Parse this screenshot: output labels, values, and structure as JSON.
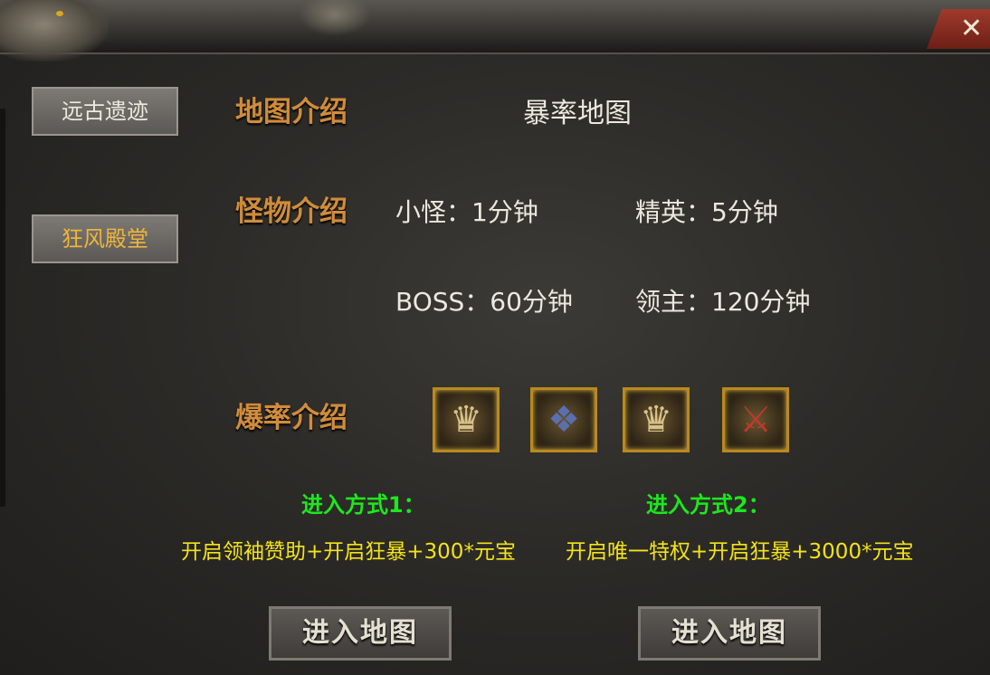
{
  "close_icon": "close-x-icon",
  "sidebar": {
    "items": [
      {
        "label": "远古遗迹",
        "active": false
      },
      {
        "label": "狂风殿堂",
        "active": true
      }
    ]
  },
  "map_intro": {
    "label": "地图介绍",
    "value": "暴率地图"
  },
  "monster_intro": {
    "label": "怪物介绍",
    "small": "小怪：1分钟",
    "elite": "精英：5分钟",
    "boss": "BOSS：60分钟",
    "lord": "领主：120分钟"
  },
  "drop_intro": {
    "label": "爆率介绍",
    "items": [
      "helmet-icon",
      "armor-icon",
      "helmet-icon",
      "sword-icon"
    ]
  },
  "entry": {
    "method1_title": "进入方式1：",
    "method1_desc": "开启领袖赞助+开启狂暴+300*元宝",
    "method2_title": "进入方式2：",
    "method2_desc": "开启唯一特权+开启狂暴+3000*元宝",
    "button1": "进入地图",
    "button2": "进入地图"
  },
  "colors": {
    "label_orange": "#d08c3c",
    "green": "#1de81d",
    "yellow": "#f3e21a",
    "active_tab": "#f0b43a"
  }
}
